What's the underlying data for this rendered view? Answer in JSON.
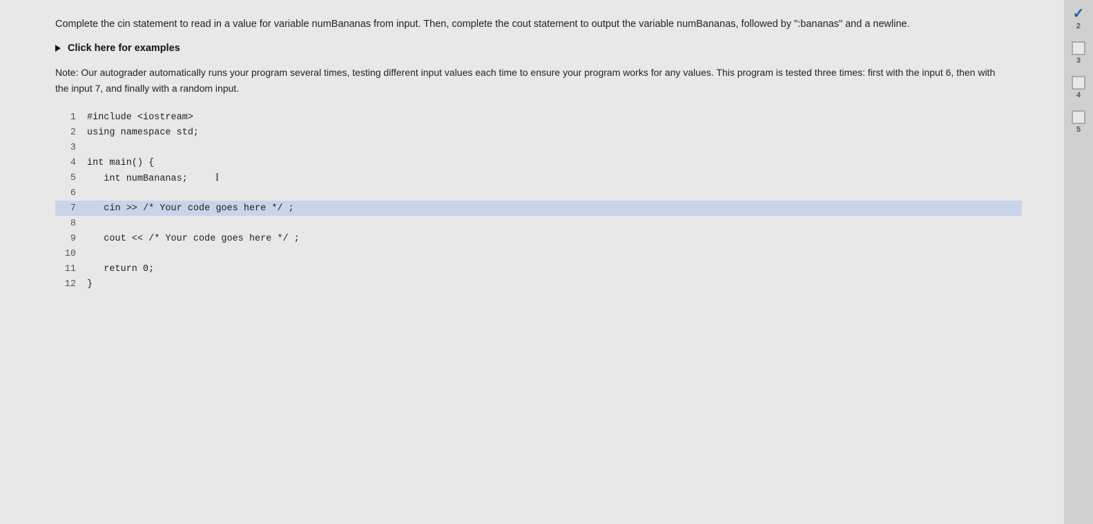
{
  "description": {
    "text": "Complete the cin statement to read in a value for variable numBananas from input. Then, complete the cout statement to output the variable numBananas, followed by \":bananas\" and a newline."
  },
  "examples_link": {
    "label": "Click here for examples"
  },
  "note": {
    "text": "Note: Our autograder automatically runs your program several times, testing different input values each time to ensure your program works for any values. This program is tested three times: first with the input 6, then with the input 7, and finally with a random input."
  },
  "code": {
    "lines": [
      {
        "number": "1",
        "content": "#include <iostream>",
        "highlighted": false
      },
      {
        "number": "2",
        "content": "using namespace std;",
        "highlighted": false
      },
      {
        "number": "3",
        "content": "",
        "highlighted": false
      },
      {
        "number": "4",
        "content": "int main() {",
        "highlighted": false
      },
      {
        "number": "5",
        "content": "   int numBananas;",
        "highlighted": false
      },
      {
        "number": "6",
        "content": "",
        "highlighted": false
      },
      {
        "number": "7",
        "content": "   cin >> /* Your code goes here */ ;",
        "highlighted": true
      },
      {
        "number": "8",
        "content": "",
        "highlighted": false
      },
      {
        "number": "9",
        "content": "   cout << /* Your code goes here */ ;",
        "highlighted": false
      },
      {
        "number": "10",
        "content": "",
        "highlighted": false
      },
      {
        "number": "11",
        "content": "   return 0;",
        "highlighted": false
      },
      {
        "number": "12",
        "content": "}",
        "highlighted": false
      }
    ]
  },
  "sidebar": {
    "items": [
      {
        "type": "check",
        "number": "2"
      },
      {
        "type": "checkbox",
        "number": "3"
      },
      {
        "type": "checkbox",
        "number": "4"
      },
      {
        "type": "checkbox",
        "number": "5"
      }
    ]
  }
}
